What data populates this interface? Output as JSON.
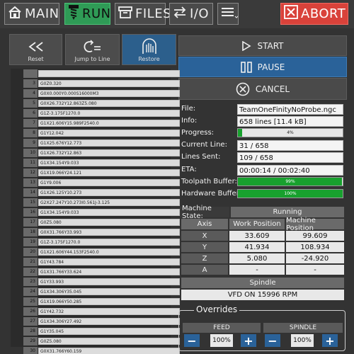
{
  "nav": {
    "main": "MAIN",
    "run": "RUN",
    "files": "FILES",
    "io": "I/O",
    "abort": "ABORT"
  },
  "controls": {
    "reset": "Reset",
    "jump_to_line": "Jump to Line",
    "restore": "Restore",
    "start": "START",
    "pause": "PAUSE",
    "cancel": "CANCEL"
  },
  "gcode_lines": [
    {
      "n": "",
      "code": ""
    },
    {
      "n": "3",
      "code": "G0Z0.320"
    },
    {
      "n": "4",
      "code": "G0X0.000Y0.000S16000M3"
    },
    {
      "n": "5",
      "code": "G0X26.732Y12.863Z5.080"
    },
    {
      "n": "6",
      "code": "G1Z-3.175F1270.0"
    },
    {
      "n": "7",
      "code": "G1X21.606Y15.989F2540.0"
    },
    {
      "n": "8",
      "code": "G1Y12.042"
    },
    {
      "n": "9",
      "code": "G1X25.676Y12.773"
    },
    {
      "n": "10",
      "code": "G1X26.732Y12.863"
    },
    {
      "n": "11",
      "code": "G1X34.154Y9.033"
    },
    {
      "n": "12",
      "code": "G1X19.066Y24.121"
    },
    {
      "n": "13",
      "code": "G1Y9.006"
    },
    {
      "n": "14",
      "code": "G1X26.125Y10.273"
    },
    {
      "n": "15",
      "code": "G2X27.247Y10.273I0.561J-3.125"
    },
    {
      "n": "16",
      "code": "G1X34.154Y9.033"
    },
    {
      "n": "17",
      "code": "G0Z5.080"
    },
    {
      "n": "18",
      "code": "G0X31.766Y33.993"
    },
    {
      "n": "19",
      "code": "G1Z-3.175F1270.0"
    },
    {
      "n": "20",
      "code": "G1X21.606Y44.153F2540.0"
    },
    {
      "n": "21",
      "code": "G1Y43.784"
    },
    {
      "n": "22",
      "code": "G1X31.766Y33.624"
    },
    {
      "n": "23",
      "code": "G1Y33.993"
    },
    {
      "n": "24",
      "code": "G1X34.306Y35.045"
    },
    {
      "n": "25",
      "code": "G1X19.066Y50.285"
    },
    {
      "n": "26",
      "code": "G1Y42.732"
    },
    {
      "n": "27",
      "code": "G1X34.306Y27.492"
    },
    {
      "n": "28",
      "code": "G1Y35.045"
    },
    {
      "n": "29",
      "code": "G0Z5.080"
    },
    {
      "n": "30",
      "code": "G0X31.766Y60.159"
    }
  ],
  "info": {
    "file_label": "File:",
    "file": "TeamOneFinityNoProbe.ngc",
    "info_label": "Info:",
    "info": "658 lines [11.4 kB]",
    "progress_label": "Progress:",
    "progress_text": "4%",
    "progress_value": 4,
    "current_line_label": "Current Line:",
    "current_line": "31 / 658",
    "lines_sent_label": "Lines Sent:",
    "lines_sent": "109 / 658",
    "eta_label": "ETA:",
    "eta": "00:00:14 / 00:02:40",
    "toolpath_label": "Toolpath Buffer:",
    "toolpath_text": "99%",
    "toolpath_value": 99,
    "hardware_label": "Hardware Buffer:",
    "hardware_text": "100%",
    "hardware_value": 100
  },
  "machine": {
    "state_label": "Machine State:",
    "state": "Running",
    "axis_hdr": "Axis",
    "work_hdr": "Work Position",
    "machine_hdr": "Machine Position",
    "axes": [
      {
        "axis": "X",
        "work": "33.609",
        "machine": "99.609"
      },
      {
        "axis": "Y",
        "work": "41.934",
        "machine": "108.934"
      },
      {
        "axis": "Z",
        "work": "5.080",
        "machine": "-24.920"
      },
      {
        "axis": "A",
        "work": "-",
        "machine": "-"
      }
    ],
    "spindle_label": "Spindle",
    "spindle": "VFD ON 15996 RPM"
  },
  "overrides": {
    "title": "Overrides",
    "feed_label": "FEED",
    "feed_value": "100%",
    "spindle_label": "SPINDLE",
    "spindle_value": "100%",
    "minus": "−",
    "plus": "+"
  },
  "colors": {
    "run_active": "#2f9b56",
    "abort": "#d9423a",
    "pause_blue": "#2a6299",
    "progress_green": "#18a12e",
    "highlight_row": "#e6e66a"
  }
}
